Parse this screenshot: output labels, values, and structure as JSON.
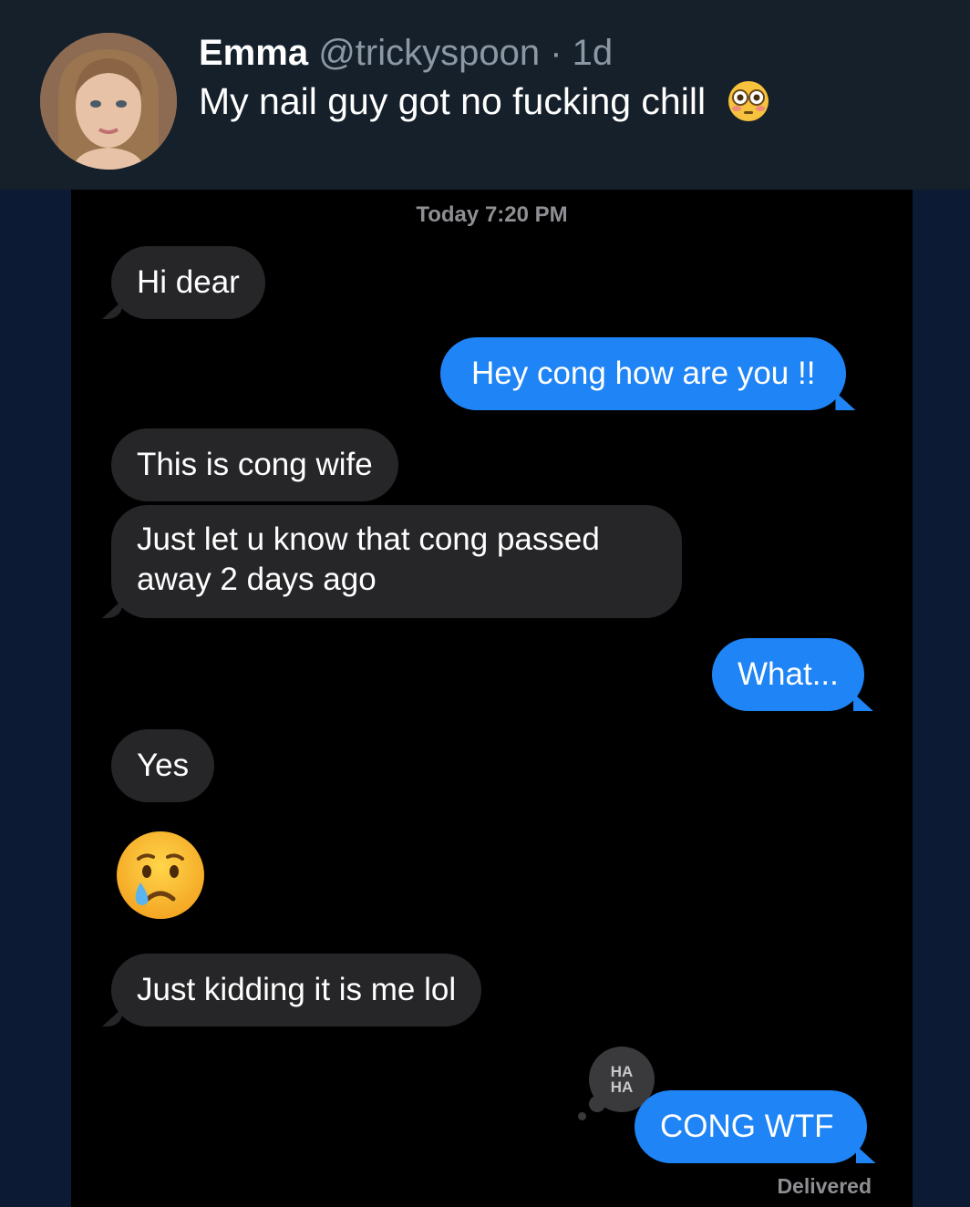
{
  "tweet": {
    "author_name": "Emma",
    "author_handle": "@trickyspoon",
    "separator": " · ",
    "age": "1d",
    "text": "My nail guy got no fucking chill",
    "emoji_icon": "flushed-face-emoji"
  },
  "chat": {
    "timestamp_label": "Today",
    "timestamp_time": "7:20 PM",
    "messages": [
      {
        "from": "them",
        "text": "Hi dear"
      },
      {
        "from": "me",
        "text": "Hey cong how are you !!"
      },
      {
        "from": "them",
        "text": "This is cong wife"
      },
      {
        "from": "them",
        "text_line1": "Just let u know that cong passed",
        "text_line2": "away 2 days ago"
      },
      {
        "from": "me",
        "text": "What..."
      },
      {
        "from": "them",
        "text": "Yes"
      },
      {
        "from": "them",
        "emoji": "crying-face-emoji"
      },
      {
        "from": "them",
        "text": "Just kidding it is me lol"
      },
      {
        "from": "me",
        "text": "CONG WTF"
      }
    ],
    "tapback": {
      "line1": "HA",
      "line2": "HA"
    },
    "status": "Delivered"
  },
  "colors": {
    "header_bg": "#15202b",
    "page_bg": "#0c1a33",
    "sent_bubble": "#1f84f5",
    "received_bubble": "#262628"
  }
}
